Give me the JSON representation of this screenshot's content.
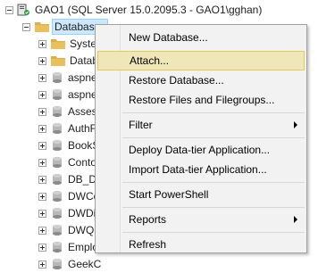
{
  "tree": {
    "server_label": "GAO1 (SQL Server 15.0.2095.3 - GAO1\\gghan)",
    "databases_label": "Databases",
    "children": [
      "System",
      "Datab",
      "aspne",
      "aspne",
      "Asses",
      "AuthF",
      "BookS",
      "Conto",
      "DB_D",
      "DWCo",
      "DWDi",
      "DWQ",
      "Emplo",
      "GeekC"
    ]
  },
  "context_menu": {
    "items": [
      {
        "label": "New Database...",
        "submenu": false
      },
      {
        "label": "Attach...",
        "submenu": false,
        "highlighted": true
      },
      {
        "label": "Restore Database...",
        "submenu": false
      },
      {
        "label": "Restore Files and Filegroups...",
        "submenu": false
      },
      {
        "label": "Filter",
        "submenu": true
      },
      {
        "label": "Deploy Data-tier Application...",
        "submenu": false
      },
      {
        "label": "Import Data-tier Application...",
        "submenu": false
      },
      {
        "label": "Start PowerShell",
        "submenu": false
      },
      {
        "label": "Reports",
        "submenu": true
      },
      {
        "label": "Refresh",
        "submenu": false
      }
    ]
  },
  "colors": {
    "selection_bg": "#cce8ff",
    "menu_highlight": "#f0e7b8",
    "folder": "#dcb048"
  }
}
